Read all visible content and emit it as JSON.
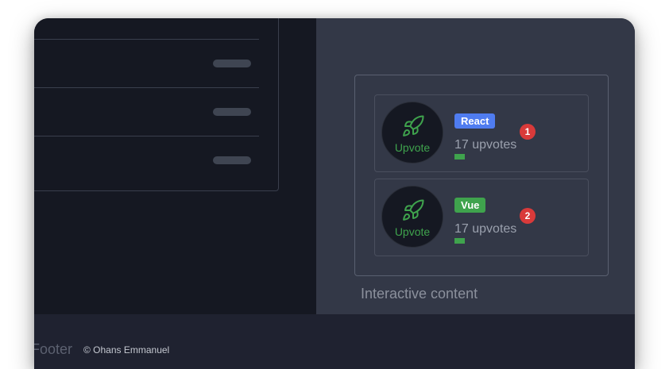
{
  "interactive": {
    "caption": "Interactive content",
    "items": [
      {
        "upvote_label": "Upvote",
        "tag": "React",
        "tag_color": "#4f7cf0",
        "count_text": "17 upvotes",
        "rank": "1"
      },
      {
        "upvote_label": "Upvote",
        "tag": "Vue",
        "tag_color": "#3fa34d",
        "count_text": "17 upvotes",
        "rank": "2"
      }
    ]
  },
  "footer": {
    "title": "Footer",
    "copyright": "© Ohans Emmanuel"
  },
  "colors": {
    "upvote_accent": "#3fa34d",
    "badge_red": "#d93a3a"
  },
  "icons": {
    "upvote": "rocket-icon"
  }
}
